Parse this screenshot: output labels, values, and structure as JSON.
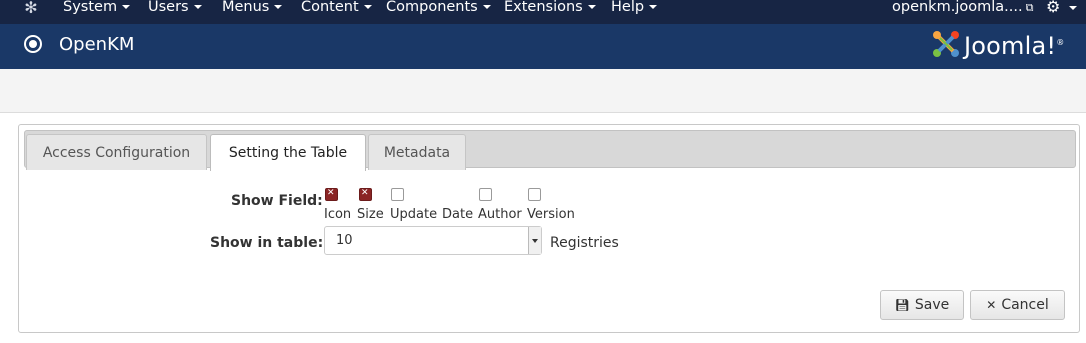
{
  "nav": {
    "logo_icon": "joomla-logo-icon",
    "menus": [
      {
        "label": "System"
      },
      {
        "label": "Users"
      },
      {
        "label": "Menus"
      },
      {
        "label": "Content"
      },
      {
        "label": "Components"
      },
      {
        "label": "Extensions"
      },
      {
        "label": "Help"
      }
    ],
    "site_link": "openkm.joomla....",
    "settings_icon": "gear-icon"
  },
  "header": {
    "title": "OpenKM",
    "brand": "Joomla!",
    "brand_mark": "®"
  },
  "tabs": [
    {
      "label": "Access Configuration",
      "active": false
    },
    {
      "label": "Setting the Table",
      "active": true
    },
    {
      "label": "Metadata",
      "active": false
    }
  ],
  "form": {
    "show_field_label": "Show Field:",
    "fields": [
      {
        "label": "Icon",
        "checked": true
      },
      {
        "label": "Size",
        "checked": true
      },
      {
        "label": "Update",
        "checked": false
      },
      {
        "label": "Date",
        "checked": false
      },
      {
        "label": "Author",
        "checked": false
      },
      {
        "label": "Version",
        "checked": false
      }
    ],
    "show_in_table_label": "Show in table:",
    "show_in_table_value": "10",
    "registries_label": "Registries"
  },
  "actions": {
    "save_label": "Save",
    "save_icon": "floppy-icon",
    "cancel_label": "Cancel",
    "cancel_icon": "close-icon"
  },
  "colors": {
    "topbar": "#172544",
    "titlebar": "#1a3867",
    "checked": "#8b2525"
  }
}
